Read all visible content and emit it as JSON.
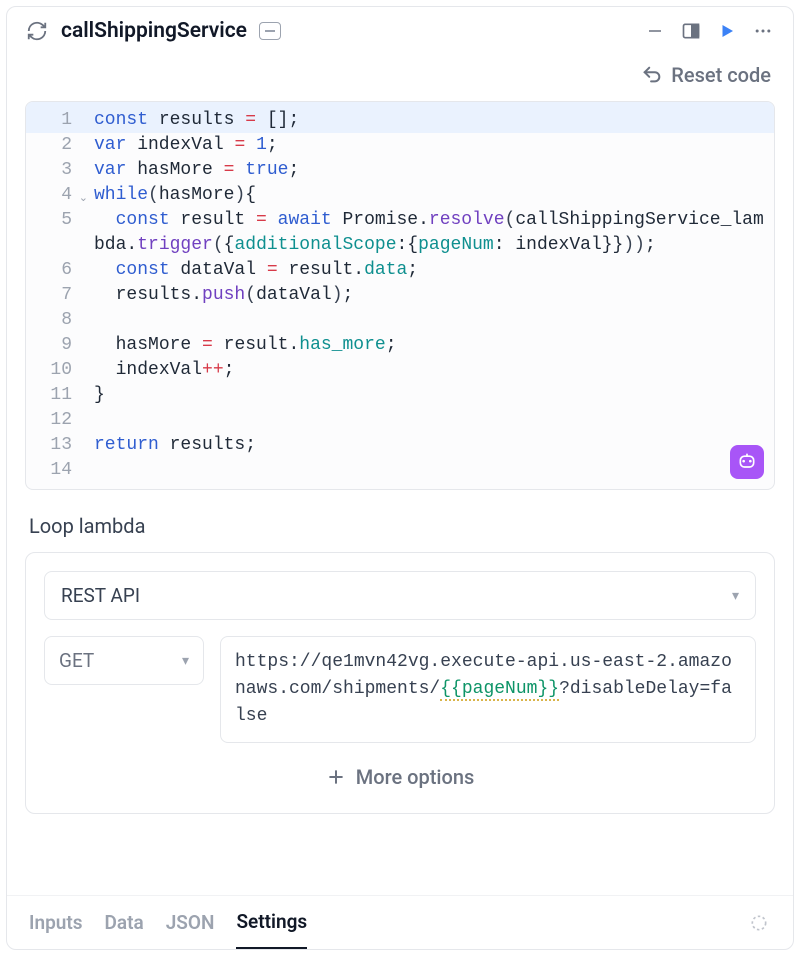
{
  "header": {
    "title": "callShippingService"
  },
  "actions": {
    "reset": "Reset code"
  },
  "code": {
    "lines": [
      {
        "n": "1",
        "indent": "",
        "t": [
          [
            "kw",
            "const"
          ],
          [
            "",
            " results "
          ],
          [
            "op",
            "="
          ],
          [
            "",
            " [];"
          ]
        ]
      },
      {
        "n": "2",
        "indent": "",
        "t": [
          [
            "kw",
            "var"
          ],
          [
            "",
            " indexVal "
          ],
          [
            "op",
            "="
          ],
          [
            "",
            " "
          ],
          [
            "bool",
            "1"
          ],
          [
            "",
            ";"
          ]
        ]
      },
      {
        "n": "3",
        "indent": "",
        "t": [
          [
            "kw",
            "var"
          ],
          [
            "",
            " hasMore "
          ],
          [
            "op",
            "="
          ],
          [
            "",
            " "
          ],
          [
            "bool",
            "true"
          ],
          [
            "",
            ";"
          ]
        ]
      },
      {
        "n": "4",
        "indent": "",
        "fold": true,
        "t": [
          [
            "kw",
            "while"
          ],
          [
            "paren",
            "("
          ],
          [
            "",
            "hasMore"
          ],
          [
            "paren",
            ")"
          ],
          [
            "",
            "{"
          ]
        ]
      },
      {
        "n": "5",
        "indent": "  ",
        "t": [
          [
            "kw",
            "const"
          ],
          [
            "",
            " result "
          ],
          [
            "op",
            "="
          ],
          [
            "",
            " "
          ],
          [
            "kw",
            "await"
          ],
          [
            "",
            " Promise."
          ],
          [
            "fn",
            "resolve"
          ],
          [
            "paren",
            "("
          ],
          [
            "",
            "callShippingService_lambda."
          ],
          [
            "fn",
            "trigger"
          ],
          [
            "paren",
            "("
          ],
          [
            "",
            "{"
          ],
          [
            "prop",
            "additionalScope"
          ],
          [
            "",
            ":{"
          ],
          [
            "prop",
            "pageNum"
          ],
          [
            "",
            ": indexVal}}"
          ],
          [
            "paren",
            "))"
          ],
          [
            "",
            ";"
          ]
        ]
      },
      {
        "n": "6",
        "indent": "  ",
        "t": [
          [
            "kw",
            "const"
          ],
          [
            "",
            " dataVal "
          ],
          [
            "op",
            "="
          ],
          [
            "",
            " result."
          ],
          [
            "prop2",
            "data"
          ],
          [
            "",
            ";"
          ]
        ]
      },
      {
        "n": "7",
        "indent": "  ",
        "t": [
          [
            "",
            "results."
          ],
          [
            "fn",
            "push"
          ],
          [
            "paren",
            "("
          ],
          [
            "",
            "dataVal"
          ],
          [
            "paren",
            ")"
          ],
          [
            "",
            ";"
          ]
        ]
      },
      {
        "n": "8",
        "indent": "",
        "t": [
          [
            "",
            ""
          ]
        ]
      },
      {
        "n": "9",
        "indent": "  ",
        "t": [
          [
            "",
            "hasMore "
          ],
          [
            "op",
            "="
          ],
          [
            "",
            " result."
          ],
          [
            "prop2",
            "has_more"
          ],
          [
            "",
            ";"
          ]
        ]
      },
      {
        "n": "10",
        "indent": "  ",
        "t": [
          [
            "",
            "indexVal"
          ],
          [
            "op",
            "++"
          ],
          [
            "",
            ";"
          ]
        ]
      },
      {
        "n": "11",
        "indent": "",
        "t": [
          [
            "",
            "}"
          ]
        ]
      },
      {
        "n": "12",
        "indent": "",
        "t": [
          [
            "",
            ""
          ]
        ]
      },
      {
        "n": "13",
        "indent": "",
        "t": [
          [
            "kw",
            "return"
          ],
          [
            "",
            " results;"
          ]
        ]
      },
      {
        "n": "14",
        "indent": "",
        "t": [
          [
            "",
            ""
          ]
        ]
      }
    ]
  },
  "lambda": {
    "section_label": "Loop lambda",
    "resource": "REST API",
    "method": "GET",
    "url_pre": "https://qe1mvn42vg.execute-api.us-east-2.amazonaws.com/shipments/",
    "url_tmpl": "{{pageNum}}",
    "url_post": "?disableDelay=false",
    "more": "More options"
  },
  "tabs": {
    "items": [
      "Inputs",
      "Data",
      "JSON",
      "Settings"
    ],
    "active": 3
  }
}
